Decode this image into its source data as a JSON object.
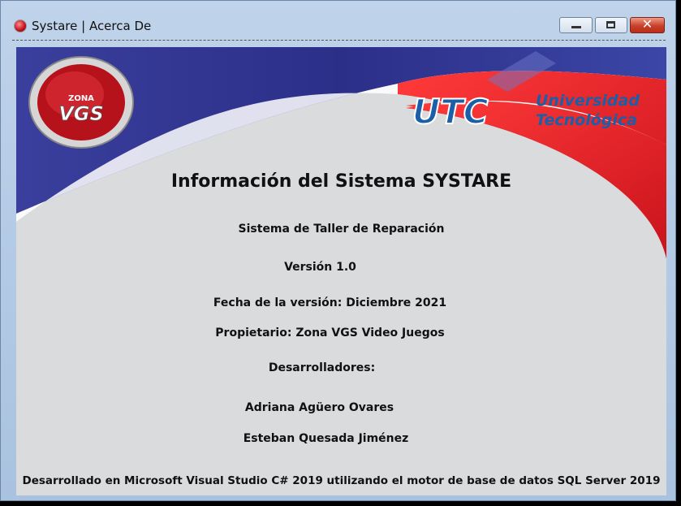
{
  "window": {
    "title": "Systare | Acerca De",
    "buttons": {
      "minimize": "minimize",
      "maximize": "maximize",
      "close": "✕"
    }
  },
  "banner": {
    "vgs_logo_text_top": "ZONA",
    "vgs_logo_text_main": "VGS",
    "utc_logo_text": "UTC",
    "utc_name_line1": "Universidad",
    "utc_name_line2": "Tecnológica",
    "colors": {
      "blue": "#2e3a9a",
      "red": "#e8232b",
      "accent": "#1a5fa8"
    }
  },
  "content": {
    "heading": "Información del Sistema SYSTARE",
    "system_name": "Sistema de Taller de Reparación",
    "version": "Versión 1.0",
    "release_date": "Fecha de la versión: Diciembre 2021",
    "owner": "Propietario: Zona VGS Video Juegos",
    "developers_label": "Desarrolladores:",
    "developers": [
      "Adriana Agüero Ovares",
      "Esteban Quesada Jiménez"
    ],
    "footer": "Desarrollado en Microsoft Visual Studio C# 2019 utilizando el motor de base de datos SQL Server 2019"
  }
}
